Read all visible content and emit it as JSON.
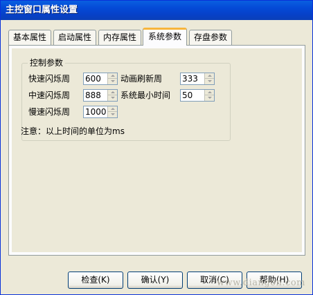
{
  "window": {
    "title": "主控窗口属性设置"
  },
  "tabs": [
    {
      "label": "基本属性",
      "active": false
    },
    {
      "label": "启动属性",
      "active": false
    },
    {
      "label": "内存属性",
      "active": false
    },
    {
      "label": "系统参数",
      "active": true
    },
    {
      "label": "存盘参数",
      "active": false
    }
  ],
  "group": {
    "title": "控制参数",
    "fast_blink_label": "快速闪烁周",
    "fast_blink_value": "600",
    "anim_refresh_label": "动画刷新周",
    "anim_refresh_value": "333",
    "mid_blink_label": "中速闪烁周",
    "mid_blink_value": "888",
    "min_time_label": "系统最小时间",
    "min_time_value": "50",
    "slow_blink_label": "慢速闪烁周",
    "slow_blink_value": "1000"
  },
  "note": "注意：以上时间的单位为ms",
  "buttons": {
    "check": "检查(K)",
    "ok": "确认(Y)",
    "cancel": "取消(C)",
    "help": "帮助(H)"
  },
  "watermark": "www.diangon.com",
  "colors": {
    "title_bar": "#0449d6",
    "active_tab_accent": "#f8b53b",
    "dialog_bg": "#ece9d8"
  }
}
